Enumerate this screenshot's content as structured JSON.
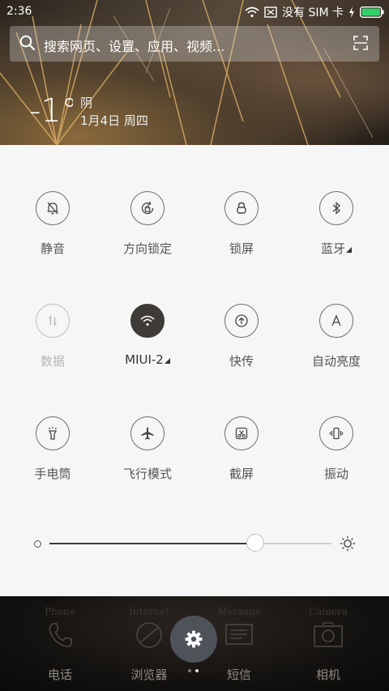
{
  "status_bar": {
    "time": "2:36",
    "carrier": "没有 SIM 卡",
    "icons": [
      "wifi-icon",
      "sim-icon",
      "charging-icon",
      "battery-icon"
    ],
    "battery_color": "#31d16a"
  },
  "search": {
    "placeholder": "搜索网页、设置、应用、视频...",
    "icons": [
      "search-icon",
      "scan-icon"
    ]
  },
  "weather": {
    "temperature": "-1°",
    "condition": "阴",
    "date": "1月4日 周四"
  },
  "toggles": [
    {
      "label": "静音",
      "icon": "bell-muted-icon",
      "state": "off"
    },
    {
      "label": "方向锁定",
      "icon": "rotation-lock-icon",
      "state": "off"
    },
    {
      "label": "锁屏",
      "icon": "lock-icon",
      "state": "off"
    },
    {
      "label": "蓝牙",
      "icon": "bluetooth-icon",
      "state": "off",
      "has_menu": true
    },
    {
      "label": "数据",
      "icon": "data-icon",
      "state": "disabled"
    },
    {
      "label": "MIUI-2",
      "icon": "wifi-icon",
      "state": "on",
      "has_menu": true
    },
    {
      "label": "快传",
      "icon": "quick-transfer-icon",
      "state": "off"
    },
    {
      "label": "自动亮度",
      "icon": "auto-brightness-icon",
      "state": "off"
    },
    {
      "label": "手电筒",
      "icon": "flashlight-icon",
      "state": "off"
    },
    {
      "label": "飞行模式",
      "icon": "airplane-icon",
      "state": "off"
    },
    {
      "label": "截屏",
      "icon": "screenshot-icon",
      "state": "off"
    },
    {
      "label": "振动",
      "icon": "vibrate-icon",
      "state": "off"
    }
  ],
  "brightness": {
    "level": 0.73
  },
  "dock": {
    "apps": [
      {
        "en": "Phone",
        "label": "电话",
        "icon": "phone-icon"
      },
      {
        "en": "Internet",
        "label": "浏览器",
        "icon": "browser-icon"
      },
      {
        "en": "Message",
        "label": "短信",
        "icon": "message-icon"
      },
      {
        "en": "Camera",
        "label": "相机",
        "icon": "camera-icon"
      }
    ],
    "settings_icon": "gear-icon",
    "page_indicator": {
      "count": 2,
      "active": 2
    }
  },
  "colors": {
    "panel_bg": "#f6f6f6",
    "active_toggle": "#3d3a37",
    "settings_button": "#4d5358"
  }
}
